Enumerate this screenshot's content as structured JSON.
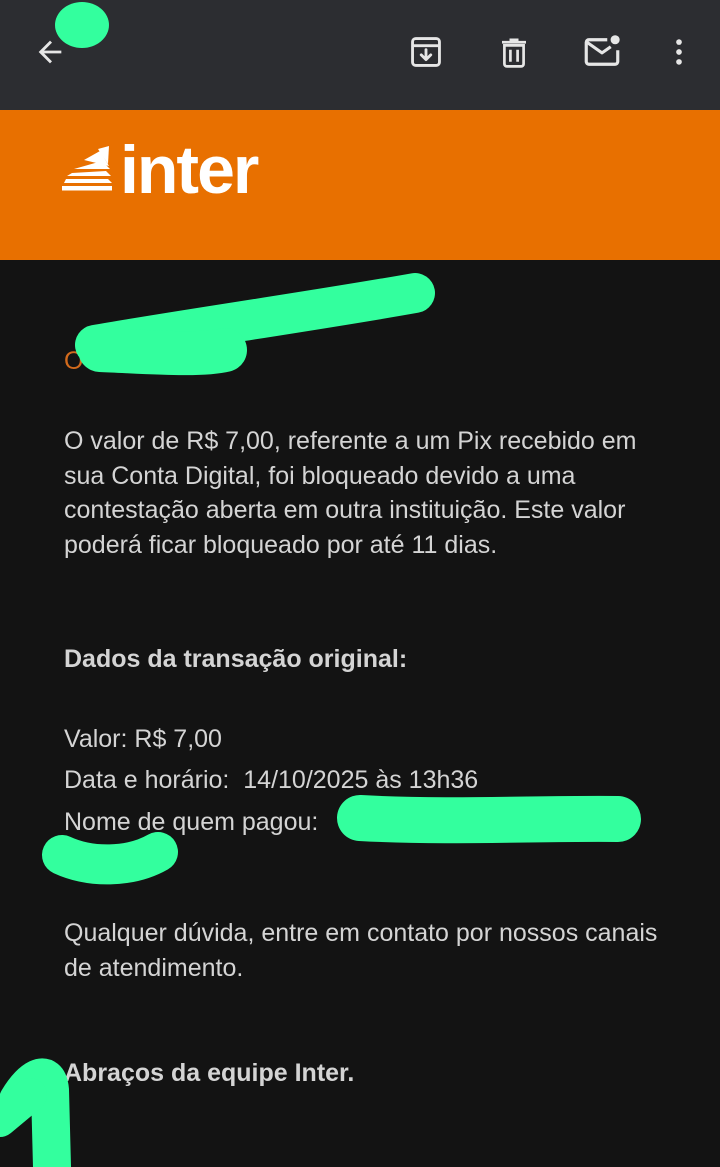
{
  "toolbar": {
    "back_icon": "arrow-back-icon",
    "archive_icon": "archive-icon",
    "delete_icon": "trash-icon",
    "mark_icon": "mark-unread-icon",
    "more_icon": "more-vertical-icon"
  },
  "banner": {
    "brand": "inter",
    "color": "#e87000"
  },
  "email": {
    "greeting": "O",
    "paragraph1": "O valor de R$ 7,00, referente a um Pix recebido em sua Conta Digital, foi bloqueado devido a uma contestação aberta em outra instituição. Este valor poderá ficar bloqueado por até 11 dias.",
    "heading": "Dados da transação original:",
    "valor": "Valor: R$ 7,00",
    "data_horario": "Data e horário:  14/10/2025 às 13h36",
    "nome": "Nome de quem pagou:",
    "paragraph2": "Qualquer dúvida, entre em contato por nossos canais de atendimento.",
    "closing": "Abraços da equipe Inter."
  },
  "colors": {
    "appbar": "#2c2d31",
    "background": "#131313",
    "text": "#d4d4d4",
    "redaction": "#33ff9e"
  }
}
